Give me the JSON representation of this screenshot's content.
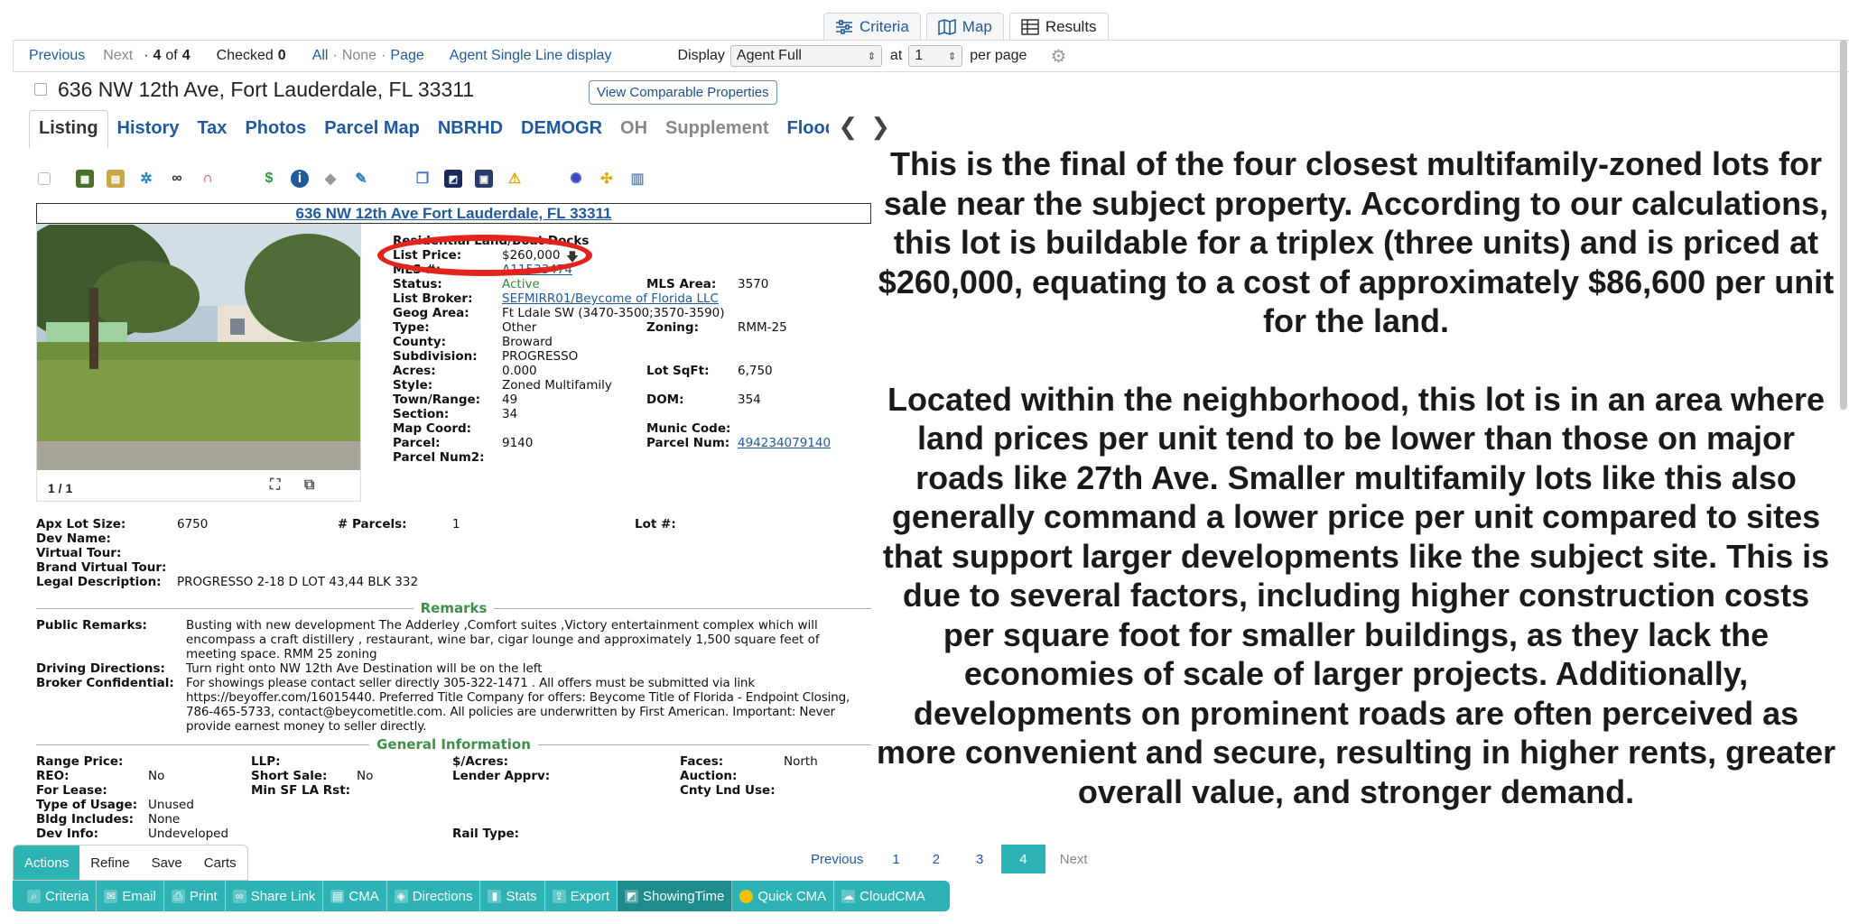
{
  "view_tabs": [
    {
      "label": "Criteria",
      "icon": "sliders-icon"
    },
    {
      "label": "Map",
      "icon": "map-icon"
    },
    {
      "label": "Results",
      "icon": "table-icon"
    }
  ],
  "nav": {
    "previous": "Previous",
    "next": "Next",
    "counter_prefix": "·",
    "current": "4",
    "of": "of",
    "total": "4",
    "checked_label": "Checked",
    "checked_count": "0",
    "all": "All",
    "none": "None",
    "page": "Page",
    "dot": "·",
    "agent_single_line": "Agent Single Line display",
    "display_label": "Display",
    "display_value": "Agent Full",
    "at_label": "at",
    "per_page_value": "1",
    "per_page_label": "per page"
  },
  "property": {
    "address": "636 NW 12th Ave, Fort Lauderdale, FL 33311",
    "comparable_button": "View Comparable Properties",
    "box_title": "636 NW 12th Ave Fort Lauderdale, FL 33311",
    "photo_counter": "1 / 1"
  },
  "sub_tabs": [
    "Listing",
    "History",
    "Tax",
    "Photos",
    "Parcel Map",
    "NBRHD",
    "DEMOGR",
    "OH",
    "Supplement",
    "Flood Ma"
  ],
  "details": {
    "category": "Residential Land/Boat Docks",
    "list_price_label": "List Price:",
    "list_price": "$260,000",
    "mls_label": "MLS #:",
    "mls_value": "A11533474",
    "status_label": "Status:",
    "status": "Active",
    "mls_area_label": "MLS Area:",
    "mls_area": "3570",
    "list_broker_label": "List Broker:",
    "list_broker": "SEFMIRR01/Beycome of Florida LLC",
    "geog_label": "Geog Area:",
    "geog": "Ft Ldale SW (3470-3500;3570-3590)",
    "type_label": "Type:",
    "type": "Other",
    "zoning_label": "Zoning:",
    "zoning": "RMM-25",
    "county_label": "County:",
    "county": "Broward",
    "subdivision_label": "Subdivision:",
    "subdivision": "PROGRESSO",
    "acres_label": "Acres:",
    "acres": "0.000",
    "lot_sqft_label": "Lot SqFt:",
    "lot_sqft": "6,750",
    "style_label": "Style:",
    "style": "Zoned Multifamily",
    "town_label": "Town/Range:",
    "town": "49",
    "dom_label": "DOM:",
    "dom": "354",
    "section_label": "Section:",
    "section": "34",
    "map_coord_label": "Map Coord:",
    "munic_label": "Munic Code:",
    "parcel_label": "Parcel:",
    "parcel": "9140",
    "parcel_num_label": "Parcel Num:",
    "parcel_num": "494234079140",
    "parcel_num2_label": "Parcel Num2:"
  },
  "lot": {
    "apx_label": "Apx Lot Size:",
    "apx": "6750",
    "parcels_label": "# Parcels:",
    "parcels": "1",
    "lot_num_label": "Lot #:",
    "dev_name_label": "Dev Name:",
    "virtual_tour_label": "Virtual Tour:",
    "brand_tour_label": "Brand Virtual Tour:",
    "legal_label": "Legal Description:",
    "legal": "PROGRESSO 2-18 D LOT 43,44 BLK 332"
  },
  "remarks": {
    "heading": "Remarks",
    "public_label": "Public Remarks:",
    "public": "Busting with new development The Adderley ,Comfort suites ,Victory entertainment complex which will encompass a craft distillery , restaurant, wine bar, cigar lounge and approximately 1,500 square feet of meeting space. RMM 25 zoning",
    "driving_label": "Driving Directions:",
    "driving": "Turn right onto NW 12th Ave Destination will be on the left",
    "broker_label": "Broker Confidential:",
    "broker": "For showings please contact seller directly 305-322-1471 . All offers must be submitted via link https://beyoffer.com/16015440. Preferred Title Company for offers: Beycome Title of Florida - Endpoint Closing, 786-465-5733, contact@beycometitle.com. All policies are underwritten by First American. Important: Never provide earnest money to seller directly."
  },
  "general": {
    "heading": "General Information",
    "range_label": "Range Price:",
    "llp_label": "LLP:",
    "per_acre_label": "$/Acres:",
    "faces_label": "Faces:",
    "faces": "North",
    "reo_label": "REO:",
    "reo": "No",
    "short_label": "Short Sale:",
    "short": "No",
    "lender_label": "Lender Apprv:",
    "auction_label": "Auction:",
    "lease_label": "For Lease:",
    "minsf_label": "Min SF LA Rst:",
    "cnty_label": "Cnty Lnd Use:",
    "usage_label": "Type of Usage:",
    "usage": "Unused",
    "bldg_label": "Bldg Includes:",
    "bldg": "None",
    "devinfo_label": "Dev Info:",
    "devinfo": "Undeveloped",
    "rail_label": "Rail Type:"
  },
  "commentary": {
    "p1": "This is the final of the four closest multifamily-zoned lots for sale near the subject property. According to our calculations, this lot is buildable for a triplex (three units) and is priced at $260,000, equating to a cost of approximately $86,600 per unit for the land.",
    "p2": "Located within the neighborhood, this lot is in an area where land prices per unit tend to be lower than those on major roads like 27th Ave. Smaller multifamily lots like this also generally command a lower price per unit compared to sites that support larger developments like the subject site. This is due to several factors, including higher construction costs per square foot for smaller buildings, as they lack the economies of scale of larger projects. Additionally, developments on prominent roads are often perceived as more convenient and secure, resulting in higher rents, greater overall value, and stronger demand."
  },
  "bottom_tabs": [
    "Actions",
    "Refine",
    "Save",
    "Carts"
  ],
  "actions": [
    "Criteria",
    "Email",
    "Print",
    "Share Link",
    "CMA",
    "Directions",
    "Stats",
    "Export",
    "ShowingTime",
    "Quick CMA",
    "CloudCMA"
  ],
  "pager": {
    "previous": "Previous",
    "pages": [
      "1",
      "2",
      "3",
      "4"
    ],
    "next": "Next"
  },
  "colors": {
    "accent": "#2db3b3",
    "link": "#1f5a9e",
    "status_active": "#2e8b3a",
    "highlight_circle": "#e2241d"
  }
}
